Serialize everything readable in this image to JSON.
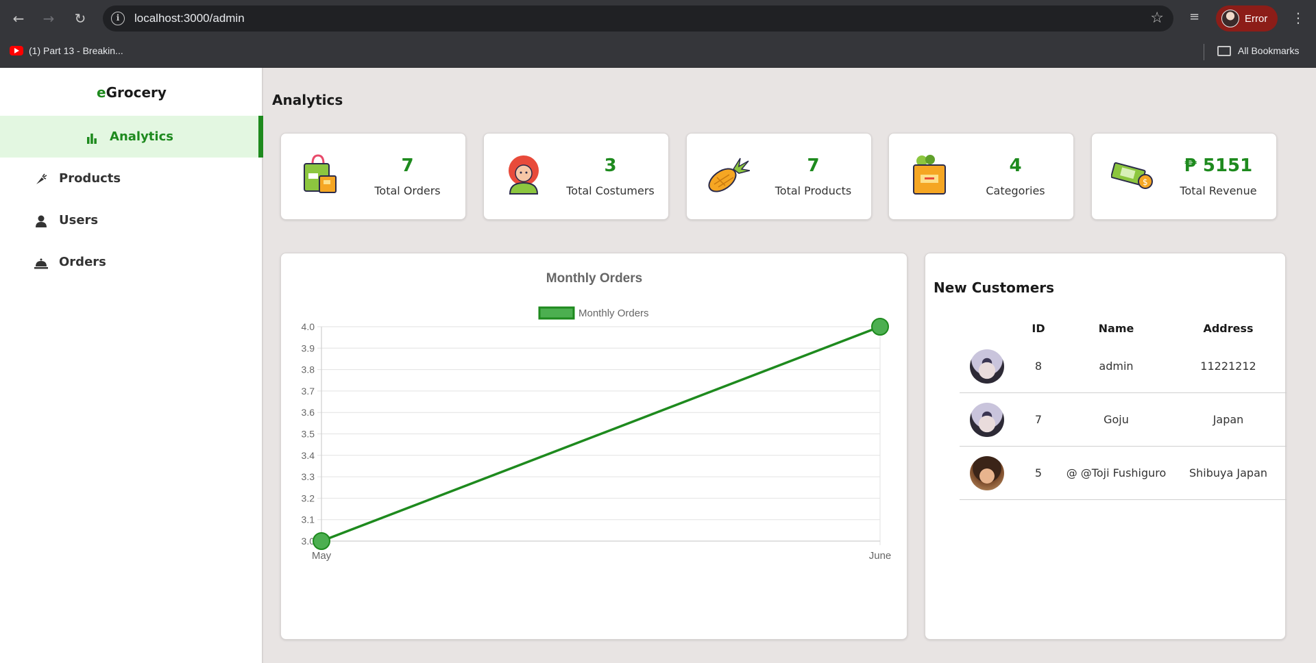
{
  "browser": {
    "url": "localhost:3000/admin",
    "profile_label": "Error",
    "bookmark": "(1) Part 13 - Breakin...",
    "all_bookmarks": "All Bookmarks"
  },
  "sidebar": {
    "brand_prefix": "e",
    "brand_rest": "Grocery",
    "items": [
      {
        "label": "Analytics",
        "icon": "bar-chart-icon",
        "active": true
      },
      {
        "label": "Products",
        "icon": "carrot-icon",
        "active": false
      },
      {
        "label": "Users",
        "icon": "user-icon",
        "active": false
      },
      {
        "label": "Orders",
        "icon": "bell-icon",
        "active": false
      }
    ]
  },
  "main": {
    "title": "Analytics",
    "cards": [
      {
        "value": "7",
        "label": "Total Orders",
        "icon": "shopping-bag-icon"
      },
      {
        "value": "3",
        "label": "Total Costumers",
        "icon": "customer-icon"
      },
      {
        "value": "7",
        "label": "Total Products",
        "icon": "pineapple-icon"
      },
      {
        "value": "4",
        "label": "Categories",
        "icon": "grocery-bag-icon"
      },
      {
        "value": "₱ 5151",
        "label": "Total Revenue",
        "icon": "money-icon"
      }
    ]
  },
  "chart_data": {
    "type": "line",
    "title": "Monthly Orders",
    "categories": [
      "May",
      "June"
    ],
    "series": [
      {
        "name": "Monthly Orders",
        "values": [
          3,
          4
        ],
        "color": "#1e8a1e"
      }
    ],
    "ylim": [
      3.0,
      4.0
    ],
    "yticks": [
      "4.0",
      "3.9",
      "3.8",
      "3.7",
      "3.6",
      "3.5",
      "3.4",
      "3.3",
      "3.2",
      "3.1",
      "3.0"
    ],
    "grid": true,
    "legend": "top"
  },
  "customers": {
    "title": "New Customers",
    "columns": [
      "",
      "ID",
      "Name",
      "Address"
    ],
    "rows": [
      {
        "id": "8",
        "name": "admin",
        "address": "11221212",
        "avatar": "goju"
      },
      {
        "id": "7",
        "name": "Goju",
        "address": "Japan",
        "avatar": "goju"
      },
      {
        "id": "5",
        "name": "@ @Toji Fushiguro",
        "address": "Shibuya Japan",
        "avatar": "toji"
      }
    ]
  }
}
